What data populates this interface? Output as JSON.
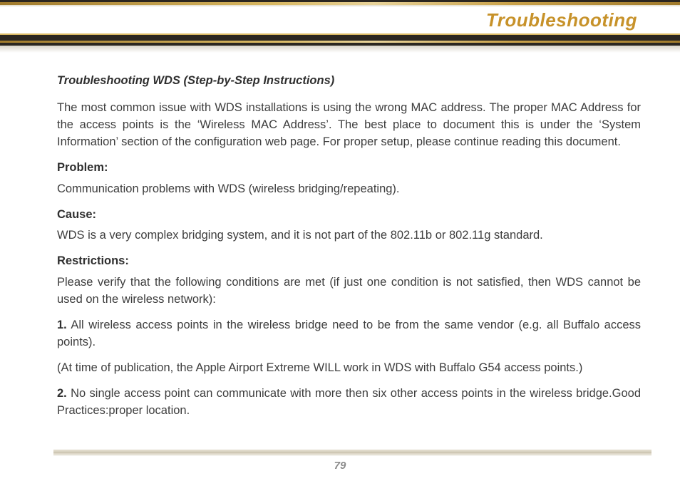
{
  "header": {
    "title": "Troubleshooting"
  },
  "content": {
    "heading": "Troubleshooting WDS (Step-by-Step Instructions)",
    "intro": "The most common issue with WDS installations is using the wrong MAC address. The proper MAC Address for the access points is the ‘Wireless MAC Address’. The best place to document this is under the ‘System Information’ section of the configuration web page. For proper setup, please continue reading this document.",
    "problem_label": "Problem:",
    "problem_text": "Communication problems with WDS (wireless bridging/repeating).",
    "cause_label": "Cause:",
    "cause_text": "WDS is a very complex bridging system, and it is not part of the 802.11b or 802.11g standard.",
    "restrictions_label": "Restrictions:",
    "restrictions_text": "Please verify that the following conditions are met (if just one condition is not satisfied, then WDS cannot be used on the wireless network):",
    "item1_num": "1.",
    "item1_text": " All wireless access points in the wireless bridge need to be from the same vendor (e.g. all Buffalo access points).",
    "item1_note": "(At time of publication, the Apple Airport Extreme WILL work in WDS with Buffalo G54 access points.)",
    "item2_num": "2.",
    "item2_text": "  No single access point can communicate with more then six other access points in the wireless bridge.Good Practices:proper location."
  },
  "footer": {
    "page_number": "79"
  }
}
